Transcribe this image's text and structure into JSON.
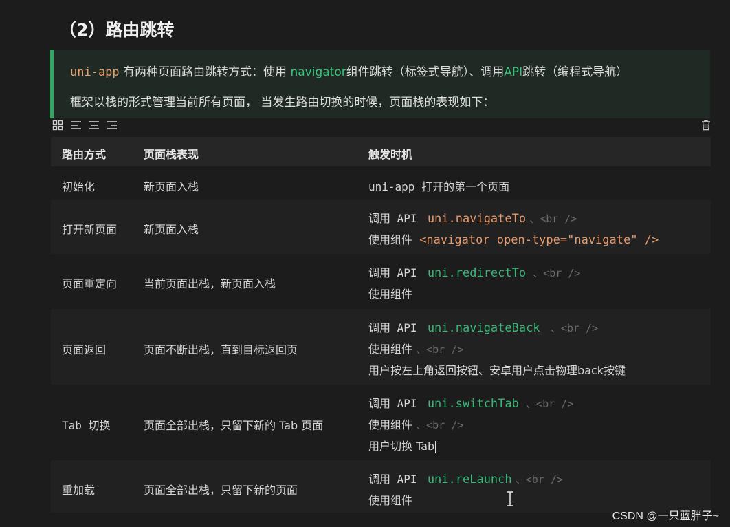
{
  "title": "（2）路由跳转",
  "callout": {
    "line1": {
      "code": "uni-app",
      "text1": " 有两种页面路由跳转方式：使用 ",
      "link1": "navigator",
      "text2": "组件跳转（标签式导航）、调用",
      "link2": "API",
      "text3": "跳转（编程式导航）"
    },
    "line2": "框架以栈的形式管理当前所有页面， 当发生路由切换的时候，页面栈的表现如下："
  },
  "toolbar": {
    "icons": [
      "grid-icon",
      "align-left-icon",
      "align-center-icon",
      "align-right-icon",
      "trash-icon"
    ]
  },
  "table": {
    "headers": [
      "路由方式",
      "页面栈表现",
      "触发时机"
    ],
    "rows": [
      {
        "method": "初始化",
        "stack": "新页面入栈",
        "trigger": [
          "uni-app 打开的第一个页面"
        ]
      },
      {
        "method": "打开新页面",
        "stack": "新页面入栈",
        "api_label": "调用 API",
        "api_fn": "uni.navigateTo",
        "br": "、<br />",
        "comp_label": "使用组件",
        "comp_code": "<navigator open-type=\"navigate\" />"
      },
      {
        "method": "页面重定向",
        "stack": "当前页面出栈，新页面入栈",
        "api_label": "调用 API",
        "api_fn": "uni.redirectTo",
        "br": "、<br />",
        "comp_label": "使用组件"
      },
      {
        "method": "页面返回",
        "stack": "页面不断出栈，直到目标返回页",
        "api_label": "调用 API",
        "api_fn": "uni.navigateBack",
        "br": "、<br />",
        "comp_label": "使用组件",
        "comp_br": "、<br />",
        "extra": "用户按左上角返回按钮、安卓用户点击物理back按键"
      },
      {
        "method": "Tab 切换",
        "stack": "页面全部出栈，只留下新的 Tab 页面",
        "api_label": "调用 API",
        "api_fn": "uni.switchTab",
        "br": "、<br />",
        "comp_label": "使用组件",
        "comp_br": "、<br />",
        "extra": "用户切换 Tab"
      },
      {
        "method": "重加载",
        "stack": "页面全部出栈，只留下新的页面",
        "api_label": "调用 API",
        "api_fn": "uni.reLaunch",
        "br": "、<br />",
        "comp_label": "使用组件"
      }
    ]
  },
  "watermark": "CSDN @一只蓝胖子~",
  "colors": {
    "background": "#1c1c1c",
    "callout_bg": "#1e2a23",
    "callout_border": "#2fa862",
    "code_orange": "#e89a6a",
    "code_green": "#37b878"
  }
}
